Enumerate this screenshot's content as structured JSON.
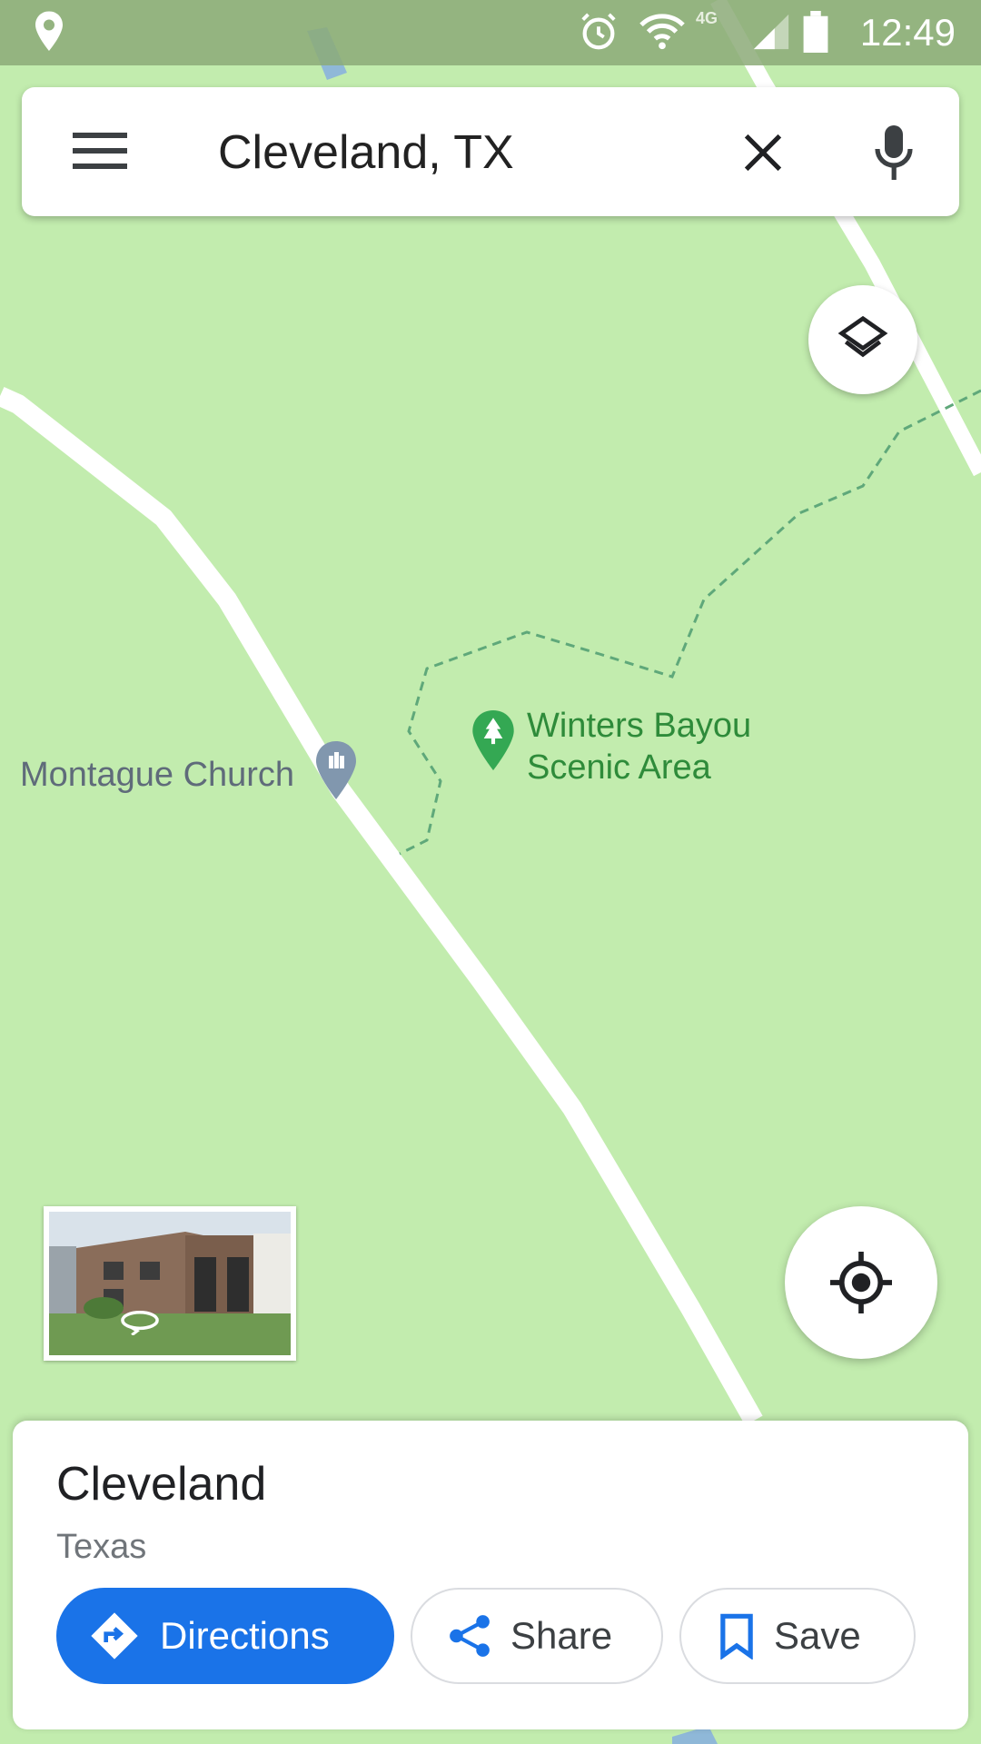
{
  "status_bar": {
    "time": "12:49",
    "icons": [
      "location-pin-icon",
      "alarm-icon",
      "wifi-icon",
      "4g-icon",
      "signal-icon",
      "battery-icon"
    ]
  },
  "search": {
    "menu_icon": "hamburger-menu-icon",
    "query": "Cleveland, TX",
    "clear_icon": "close-icon",
    "voice_icon": "microphone-icon"
  },
  "map": {
    "layers_icon": "layers-icon",
    "my_location_icon": "my-location-icon",
    "labels": {
      "church": "Montague Church",
      "park_line1": "Winters Bayou",
      "park_line2": "Scenic Area"
    },
    "colors": {
      "park_green": "#c2ecae",
      "park_label": "#2e8b3a",
      "poi_label": "#5f6b7a",
      "road": "#ffffff"
    }
  },
  "street_view": {
    "icon": "360-rotate-icon"
  },
  "place": {
    "title": "Cleveland",
    "subtitle": "Texas"
  },
  "actions": {
    "directions_label": "Directions",
    "share_label": "Share",
    "save_label": "Save",
    "accent": "#1a73e8"
  }
}
